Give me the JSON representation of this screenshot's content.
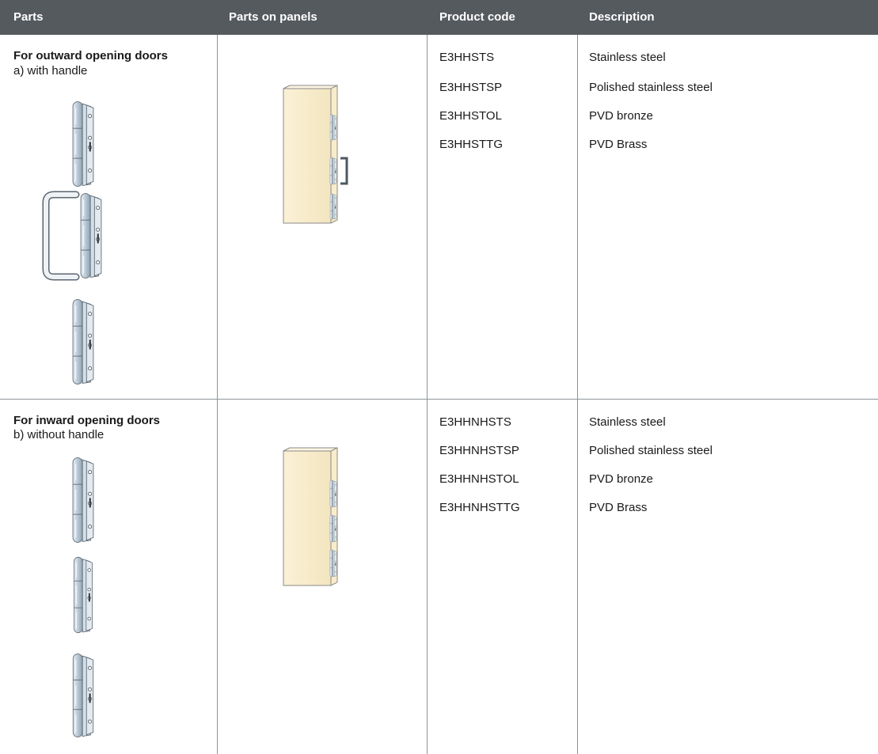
{
  "table": {
    "headers": [
      "Parts",
      "Parts on panels",
      "Product code",
      "Description"
    ],
    "sections": [
      {
        "title": "For outward opening doors",
        "subtitle": "a) with handle",
        "parts_icons": [
          "hinge-icon",
          "hinge-with-handle-icon",
          "hinge-icon"
        ],
        "panel_icon": "panel-with-handle-hinges-icon",
        "rows": [
          {
            "code": "E3HHSTS",
            "description": "Stainless steel"
          },
          {
            "code": "E3HHSTSP",
            "description": "Polished stainless steel"
          },
          {
            "code": "E3HHSTOL",
            "description": "PVD bronze"
          },
          {
            "code": "E3HHSTTG",
            "description": "PVD Brass"
          }
        ]
      },
      {
        "title": "For inward opening doors",
        "subtitle": "b) without handle",
        "parts_icons": [
          "hinge-icon",
          "hinge-icon",
          "hinge-icon"
        ],
        "panel_icon": "panel-with-hinges-icon",
        "rows": [
          {
            "code": "E3HHNHSTS",
            "description": "Stainless steel"
          },
          {
            "code": "E3HHNHSTSP",
            "description": "Polished stainless steel"
          },
          {
            "code": "E3HHNHSTOL",
            "description": "PVD bronze"
          },
          {
            "code": "E3HHNHSTTG",
            "description": "PVD Brass"
          }
        ]
      }
    ]
  },
  "colors": {
    "header_bg": "#555a5f",
    "header_text": "#ffffff",
    "rule": "#8f9397",
    "panel_fill": "#f8eccb",
    "hinge_metal": "#b9c9d6"
  }
}
